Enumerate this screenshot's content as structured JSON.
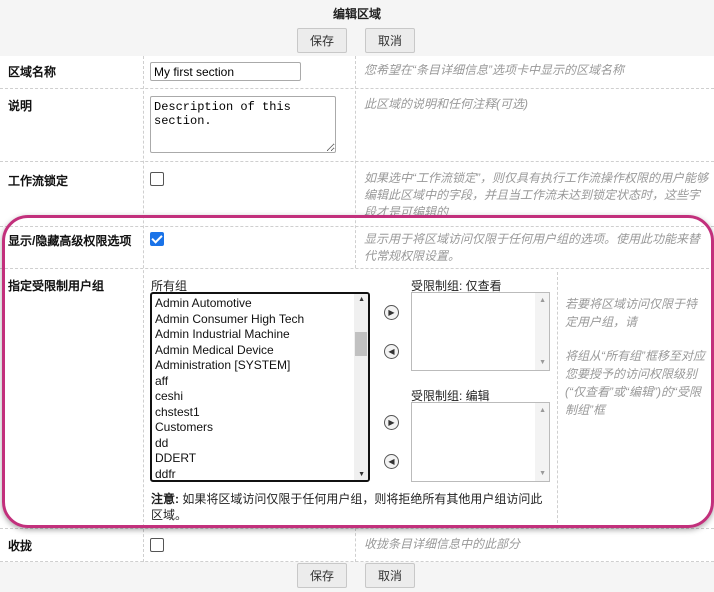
{
  "title": "编辑区域",
  "buttons": {
    "save": "保存",
    "cancel": "取消"
  },
  "rows": {
    "name": {
      "label": "区域名称",
      "value": "My first section",
      "desc": "您希望在“条目详细信息”选项卡中显示的区域名称"
    },
    "description": {
      "label": "说明",
      "value": "Description of this section.",
      "desc": "此区域的说明和任何注释(可选)"
    },
    "workflow_lock": {
      "label": "工作流锁定",
      "checked": false,
      "desc": "如果选中“工作流锁定”，则仅具有执行工作流操作权限的用户能够编辑此区域中的字段，并且当工作流未达到锁定状态时，这些字段才是可编辑的"
    },
    "advanced": {
      "label": "显示/隐藏高级权限选项",
      "checked": true,
      "desc": "显示用于将区域访问仅限于任何用户组的选项。使用此功能来替代常规权限设置。"
    },
    "groups": {
      "label": "指定受限制用户组",
      "all_label": "所有组",
      "all_groups": [
        "Admin Automotive",
        "Admin Consumer High Tech",
        "Admin Industrial Machine",
        "Admin Medical Device",
        "Administration [SYSTEM]",
        "aff",
        "ceshi",
        "chstest1",
        "Customers",
        "dd",
        "DDERT",
        "ddfr"
      ],
      "view_label": "受限制组: 仅查看",
      "edit_label": "受限制组: 编辑",
      "note_bold": "注意:",
      "note": " 如果将区域访问仅限于任何用户组，则将拒绝所有其他用户组访问此区域。",
      "desc1": "若要将区域访问仅限于特定用户组，请",
      "desc2": "将组从“所有组”框移至对应您要授予的访问权限级别(“仅查看”或“编辑”)的“受限制组”框"
    },
    "collapse": {
      "label": "收拢",
      "checked": false,
      "desc": "收拢条目详细信息中的此部分"
    }
  },
  "highlight_color": "#c2307c"
}
